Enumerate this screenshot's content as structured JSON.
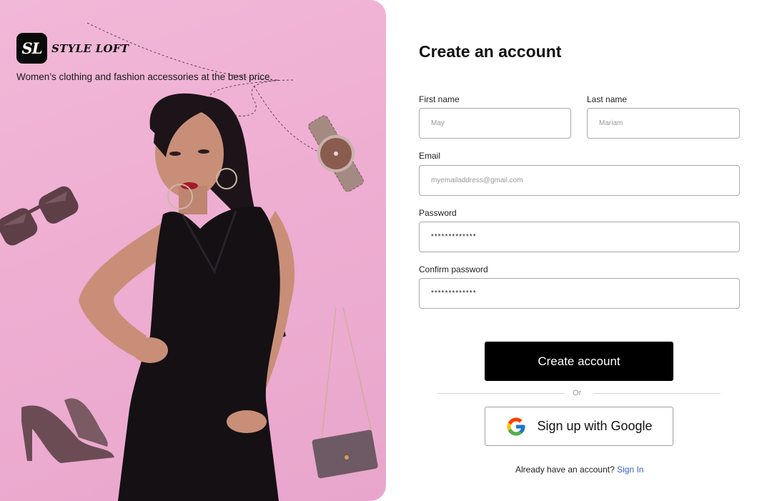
{
  "brand": {
    "logo_text": "SL",
    "name": "STYLE LOFT",
    "tagline": "Women’s clothing and fashion accessories at the best price."
  },
  "form": {
    "title": "Create an account",
    "first_name": {
      "label": "First name",
      "placeholder": "May"
    },
    "last_name": {
      "label": "Last name",
      "placeholder": "Mariam"
    },
    "email": {
      "label": "Email",
      "placeholder": "myemailaddress@gmail.com"
    },
    "password": {
      "label": "Password",
      "value": "*************"
    },
    "confirm_password": {
      "label": "Confirm password",
      "value": "*************"
    },
    "submit_label": "Create account",
    "divider_text": "Or",
    "google_label": "Sign up with Google",
    "signin_prompt": "Already have an account?",
    "signin_link": "Sign In"
  },
  "icons": {
    "google": "google-g-logo",
    "hero_items": [
      "sunglasses-icon",
      "wristwatch-icon",
      "high-heels-icon",
      "handbag-icon"
    ]
  },
  "colors": {
    "hero_background": "#eeaed2",
    "primary_button": "#000000",
    "link": "#3b5bcc"
  }
}
